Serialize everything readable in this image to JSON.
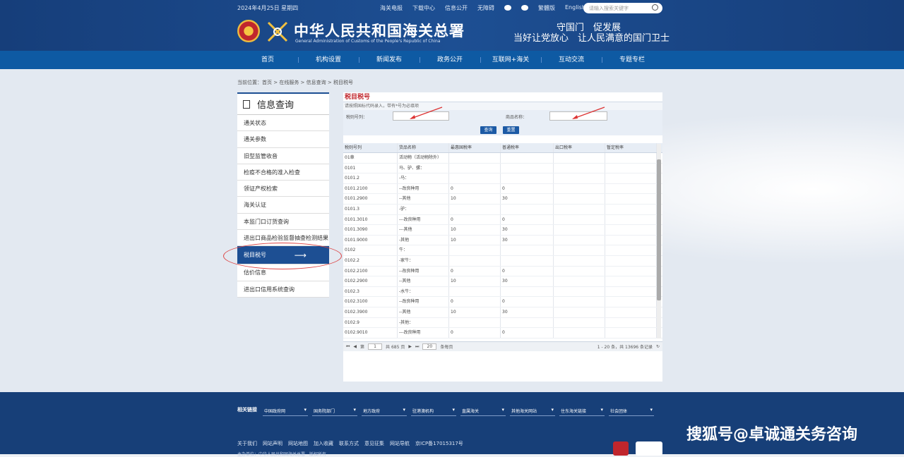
{
  "header": {
    "date": "2024年4月25日 星期四",
    "top_links": [
      "海关电报",
      "下载中心",
      "信息公开",
      "无障碍",
      "微博",
      "微信",
      "繁體版",
      "English"
    ],
    "search_placeholder": "请输入搜索关键字",
    "title_cn": "中华人民共和国海关总署",
    "title_en": "General Administration of Customs of the People's Republic of China",
    "slogan_line1": "守国门　促发展",
    "slogan_line2": "当好让党放心　让人民满意的国门卫士"
  },
  "nav": [
    "首页",
    "机构设置",
    "新闻发布",
    "政务公开",
    "互联网+海关",
    "互动交流",
    "专题专栏"
  ],
  "breadcrumb": "当前位置：首页 > 在线服务 > 信息查询 > 税目税号",
  "sidebar": {
    "title": "信息查询",
    "items": [
      "通关状态",
      "通关参数",
      "旧型监管收音",
      "检疫不合格的准入检查",
      "领证产权检索",
      "海关认证",
      "本监门口订货查询",
      "进出口商品检验监督抽查检测结果查询",
      "税目税号",
      "估价信息",
      "进出口信用系统查询"
    ],
    "active_index": 8
  },
  "main": {
    "title": "税目税号",
    "tip": "请按照国标代码录入，带有*号为必填项",
    "field1_label": "税则号列：",
    "field2_label": "商品名称：",
    "query_button": "查询",
    "reset_button": "重置",
    "columns": [
      "税则号列",
      "货品名称",
      "最惠国税率",
      "普通税率",
      "出口税率",
      "暂定税率"
    ],
    "rows": [
      [
        "01章",
        "活动物（活动物除外）",
        "",
        "",
        "",
        ""
      ],
      [
        "0101",
        "马、驴、骡：",
        "",
        "",
        "",
        ""
      ],
      [
        "0101.2",
        "-马：",
        "",
        "",
        "",
        ""
      ],
      [
        "0101.2100",
        "--改良种用",
        "0",
        "0",
        "",
        ""
      ],
      [
        "0101.2900",
        "--其他",
        "10",
        "30",
        "",
        ""
      ],
      [
        "0101.3",
        "-驴：",
        "",
        "",
        "",
        ""
      ],
      [
        "0101.3010",
        "---改良种用",
        "0",
        "0",
        "",
        ""
      ],
      [
        "0101.3090",
        "---其他",
        "10",
        "30",
        "",
        ""
      ],
      [
        "0101.9000",
        "-其他",
        "10",
        "30",
        "",
        ""
      ],
      [
        "0102",
        "牛：",
        "",
        "",
        "",
        ""
      ],
      [
        "0102.2",
        "-家牛：",
        "",
        "",
        "",
        ""
      ],
      [
        "0102.2100",
        "--改良种用",
        "0",
        "0",
        "",
        ""
      ],
      [
        "0102.2900",
        "--其他",
        "10",
        "30",
        "",
        ""
      ],
      [
        "0102.3",
        "-水牛：",
        "",
        "",
        "",
        ""
      ],
      [
        "0102.3100",
        "--改良种用",
        "0",
        "0",
        "",
        ""
      ],
      [
        "0102.3900",
        "--其他",
        "10",
        "30",
        "",
        ""
      ],
      [
        "0102.9",
        "-其他：",
        "",
        "",
        "",
        ""
      ],
      [
        "0102.9010",
        "---改良种用",
        "0",
        "0",
        "",
        ""
      ]
    ],
    "pager": {
      "page_label": "第",
      "current_page": "1",
      "total_label": "共 685 页",
      "page_size": "20",
      "per_page_label": "条每页",
      "range_label": "1 - 20 条，共 13696 条记录"
    }
  },
  "footer": {
    "links_label": "相关链接",
    "selects": [
      "中国政府网",
      "国务院部门",
      "地方政府",
      "驻港澳机构",
      "直属海关",
      "其他海关网站",
      "住东海关链接",
      "社会团体"
    ],
    "bottom_links": [
      "关于我们",
      "网站声明",
      "网站地图",
      "加入收藏",
      "联系方式",
      "意见征集",
      "网站导航",
      "京ICP备17015317号"
    ],
    "bottom_line2": "主办单位：中华人民共和国海关总署　版权所有"
  },
  "watermark": "搜狐号@卓诚通关务咨询"
}
